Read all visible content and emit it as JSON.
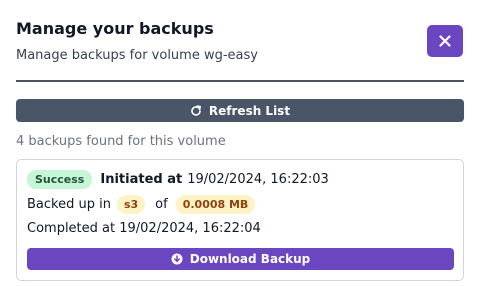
{
  "modal": {
    "title": "Manage your backups",
    "subtitle": "Manage backups for volume wg-easy"
  },
  "toolbar": {
    "refresh_label": "Refresh List"
  },
  "summary": {
    "count_text": "4 backups found for this volume"
  },
  "backup": {
    "status": "Success",
    "initiated_label": "Initiated at",
    "initiated_at": "19/02/2024, 16:22:03",
    "backed_up_label": "Backed up in",
    "storage": "s3",
    "of_label": "of",
    "size": "0.0008 MB",
    "completed_text": "Completed at 19/02/2024, 16:22:04",
    "download_label": "Download Backup"
  },
  "icons": {
    "close": "close-icon",
    "refresh": "refresh-icon",
    "download": "download-icon"
  },
  "colors": {
    "primary": "#6b46c1",
    "secondary": "#4a5568",
    "success_bg": "#c6f6d5",
    "warning_bg": "#fef3c7"
  }
}
